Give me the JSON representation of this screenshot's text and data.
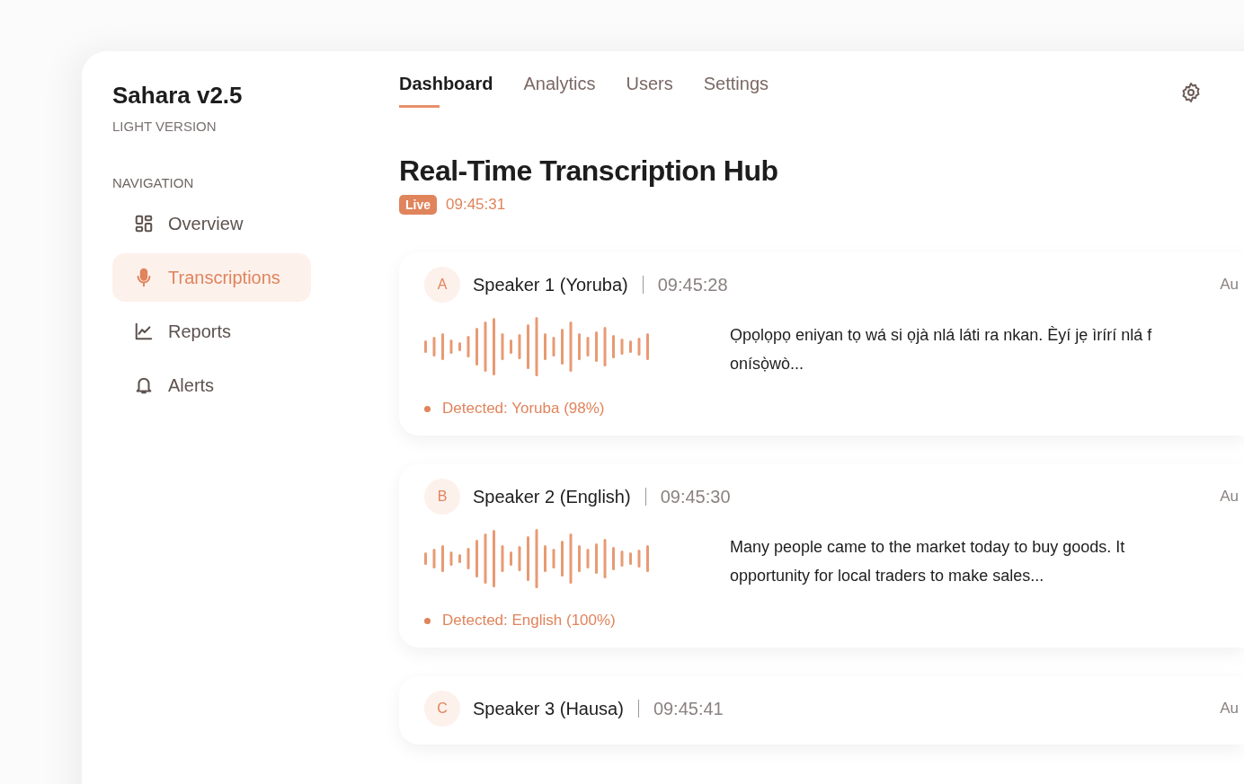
{
  "app": {
    "title": "Sahara v2.5",
    "subtitle": "LIGHT VERSION"
  },
  "navigation": {
    "heading": "NAVIGATION",
    "items": [
      {
        "label": "Overview",
        "selected": false
      },
      {
        "label": "Transcriptions",
        "selected": true
      },
      {
        "label": "Reports",
        "selected": false
      },
      {
        "label": "Alerts",
        "selected": false
      }
    ]
  },
  "tabs": [
    {
      "label": "Dashboard",
      "selected": true
    },
    {
      "label": "Analytics",
      "selected": false
    },
    {
      "label": "Users",
      "selected": false
    },
    {
      "label": "Settings",
      "selected": false
    }
  ],
  "page": {
    "title": "Real-Time Transcription Hub",
    "badge": "Live",
    "time": "09:45:31"
  },
  "entries": [
    {
      "avatar": "A",
      "speaker": "Speaker 1 (Yoruba)",
      "time": "09:45:28",
      "column_3": "Au",
      "detected": "Detected: Yoruba (98%)",
      "transcript": [
        "Ọpọlọpọ eniyan tọ wá si ọjà nlá láti ra nkan. Èyí jẹ ìrírí nlá f",
        "onísọ̀wò..."
      ]
    },
    {
      "avatar": "B",
      "speaker": "Speaker 2 (English)",
      "time": "09:45:30",
      "column_3": "Au",
      "detected": "Detected: English (100%)",
      "transcript": [
        "Many people came to the market today to buy goods. It",
        "opportunity for local traders to make sales..."
      ]
    },
    {
      "avatar": "C",
      "speaker": "Speaker 3 (Hausa)",
      "time": "09:45:41",
      "column_3": "Au"
    }
  ]
}
